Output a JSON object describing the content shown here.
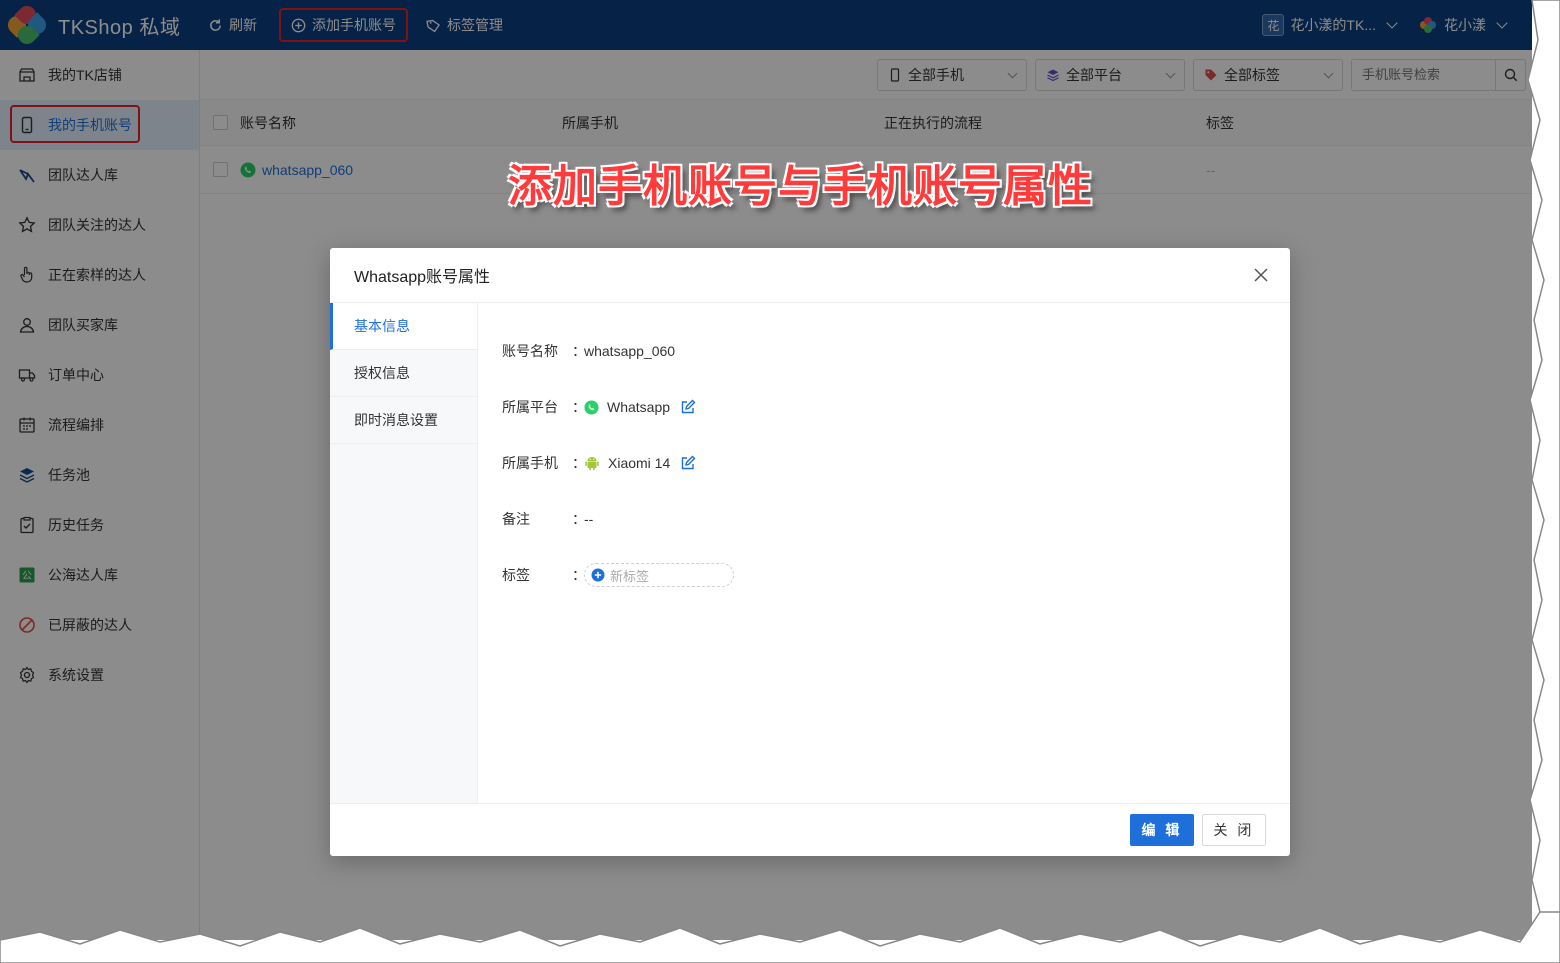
{
  "header": {
    "title": "TKShop 私域",
    "refresh_label": "刷新",
    "add_account_label": "添加手机账号",
    "tag_manage_label": "标签管理",
    "shop_badge": "花",
    "shop_name": "花小漾的TK...",
    "user_name": "花小漾",
    "bg_color": "#0c3f82"
  },
  "sidebar": {
    "items": [
      {
        "label": "我的TK店铺",
        "icon": "store-icon"
      },
      {
        "label": "我的手机账号",
        "icon": "phone-icon"
      },
      {
        "label": "团队达人库",
        "icon": "team-creator-icon"
      },
      {
        "label": "团队关注的达人",
        "icon": "star-icon"
      },
      {
        "label": "正在索样的达人",
        "icon": "hand-pointer-icon"
      },
      {
        "label": "团队买家库",
        "icon": "user-icon"
      },
      {
        "label": "订单中心",
        "icon": "truck-icon"
      },
      {
        "label": "流程编排",
        "icon": "calendar-icon"
      },
      {
        "label": "任务池",
        "icon": "layers-icon"
      },
      {
        "label": "历史任务",
        "icon": "clipboard-check-icon"
      },
      {
        "label": "公海达人库",
        "icon": "public-icon"
      },
      {
        "label": "已屏蔽的达人",
        "icon": "block-icon"
      },
      {
        "label": "系统设置",
        "icon": "gear-icon"
      }
    ],
    "active_index": 1
  },
  "toolbar": {
    "phone_filter": "全部手机",
    "platform_filter": "全部平台",
    "tag_filter": "全部标签",
    "search_placeholder": "手机账号检索"
  },
  "table": {
    "headers": [
      "账号名称",
      "所属手机",
      "正在执行的流程",
      "标签"
    ],
    "rows": [
      {
        "name": "whatsapp_060",
        "phone": "",
        "flow": "",
        "tag": "--"
      }
    ]
  },
  "caption": "添加手机账号与手机账号属性",
  "modal": {
    "title": "Whatsapp账号属性",
    "tabs": [
      "基本信息",
      "授权信息",
      "即时消息设置"
    ],
    "active_tab": 0,
    "fields": {
      "name_label": "账号名称",
      "name_value": "whatsapp_060",
      "platform_label": "所属平台",
      "platform_value": "Whatsapp",
      "phone_label": "所属手机",
      "phone_value": "Xiaomi 14",
      "note_label": "备注",
      "note_value": "--",
      "tag_label": "标签",
      "tag_new": "新标签",
      "colon": "："
    },
    "edit_label": "编 辑",
    "close_label": "关 闭"
  },
  "colors": {
    "accent": "#1e6fd9",
    "highlight_box": "#e8202a",
    "whatsapp_green": "#25d366",
    "android_green": "#a4c639"
  }
}
